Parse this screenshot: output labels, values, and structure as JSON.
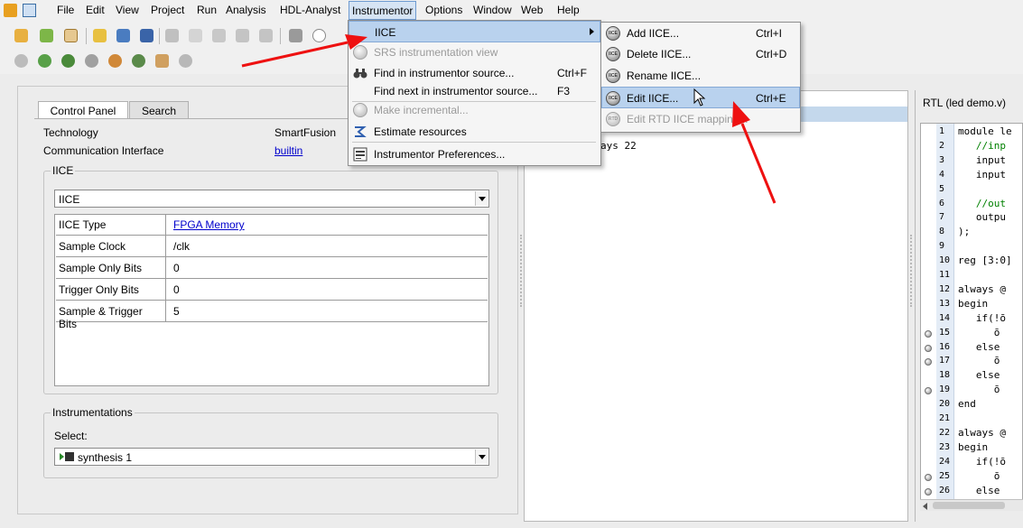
{
  "menubar": {
    "items": [
      "File",
      "Edit",
      "View",
      "Project",
      "Run",
      "Analysis",
      "HDL-Analyst",
      "Instrumentor",
      "Options",
      "Window",
      "Web",
      "Help"
    ]
  },
  "left_panel": {
    "tabs": [
      "Control Panel",
      "Search"
    ],
    "technology_label": "Technology",
    "technology_value": "SmartFusion",
    "comm_label": "Communication Interface",
    "comm_value": "builtin",
    "iice_group_title": "IICE",
    "iice_select_value": "IICE",
    "properties": [
      {
        "key": "IICE Type",
        "value": " FPGA Memory"
      },
      {
        "key": "Sample Clock",
        "value": "/clk"
      },
      {
        "key": "Sample Only Bits",
        "value": "0"
      },
      {
        "key": "Trigger Only Bits",
        "value": "0"
      },
      {
        "key": "Sample & Trigger Bits",
        "value": "5"
      }
    ],
    "instrumentations_title": "Instrumentations",
    "select_label": "Select:",
    "synthesis_value": "synthesis  1"
  },
  "middle_pane": {
    "visible_text": "ays 22"
  },
  "right_pane": {
    "title": "RTL (led  demo.v)",
    "lines": [
      {
        "n": "1",
        "code": "module le"
      },
      {
        "n": "2",
        "code": "   //inp"
      },
      {
        "n": "3",
        "code": "   input"
      },
      {
        "n": "4",
        "code": "   input"
      },
      {
        "n": "5",
        "code": ""
      },
      {
        "n": "6",
        "code": "   //out"
      },
      {
        "n": "7",
        "code": "   outpu"
      },
      {
        "n": "8",
        "code": ");"
      },
      {
        "n": "9",
        "code": ""
      },
      {
        "n": "10",
        "code": "reg [3:0]"
      },
      {
        "n": "11",
        "code": ""
      },
      {
        "n": "12",
        "code": "always @"
      },
      {
        "n": "13",
        "code": "begin"
      },
      {
        "n": "14",
        "code": "   if(!ō"
      },
      {
        "n": "15",
        "code": "      ō"
      },
      {
        "n": "16",
        "code": "   else"
      },
      {
        "n": "17",
        "code": "      ō"
      },
      {
        "n": "18",
        "code": "   else"
      },
      {
        "n": "19",
        "code": "      ō"
      },
      {
        "n": "20",
        "code": "end"
      },
      {
        "n": "21",
        "code": ""
      },
      {
        "n": "22",
        "code": "always @"
      },
      {
        "n": "23",
        "code": "begin"
      },
      {
        "n": "24",
        "code": "   if(!ō"
      },
      {
        "n": "25",
        "code": "      ō"
      },
      {
        "n": "26",
        "code": "   else"
      }
    ]
  },
  "instrumentor_menu": {
    "items": [
      {
        "label": "IICE",
        "shortcut": "",
        "submenu": true,
        "disabled": false
      },
      {
        "label": "SRS instrumentation view",
        "shortcut": "",
        "disabled": true
      },
      {
        "label": "Find in instrumentor source...",
        "shortcut": "Ctrl+F",
        "disabled": false
      },
      {
        "label": "Find next in instrumentor source...",
        "shortcut": "F3",
        "disabled": false
      },
      {
        "label": "Make incremental...",
        "shortcut": "",
        "disabled": true
      },
      {
        "label": "Estimate resources",
        "shortcut": "",
        "disabled": false
      },
      {
        "label": "Instrumentor Preferences...",
        "shortcut": "",
        "disabled": false
      }
    ]
  },
  "iice_submenu": {
    "items": [
      {
        "label": "Add IICE...",
        "shortcut": "Ctrl+I",
        "icon_text": "IICE",
        "disabled": false
      },
      {
        "label": "Delete IICE...",
        "shortcut": "Ctrl+D",
        "icon_text": "IICE",
        "disabled": false
      },
      {
        "label": "Rename IICE...",
        "shortcut": "",
        "icon_text": "IICE",
        "disabled": false
      },
      {
        "label": "Edit IICE...",
        "shortcut": "Ctrl+E",
        "icon_text": "IICE",
        "disabled": false
      },
      {
        "label": "Edit RTD IICE mapping...",
        "shortcut": "",
        "icon_text": "RTD",
        "disabled": true
      }
    ]
  },
  "colors": {
    "annotation_arrow": "#ee1111",
    "menu_highlight": "#b9d2ee",
    "link": "#0000cc"
  }
}
